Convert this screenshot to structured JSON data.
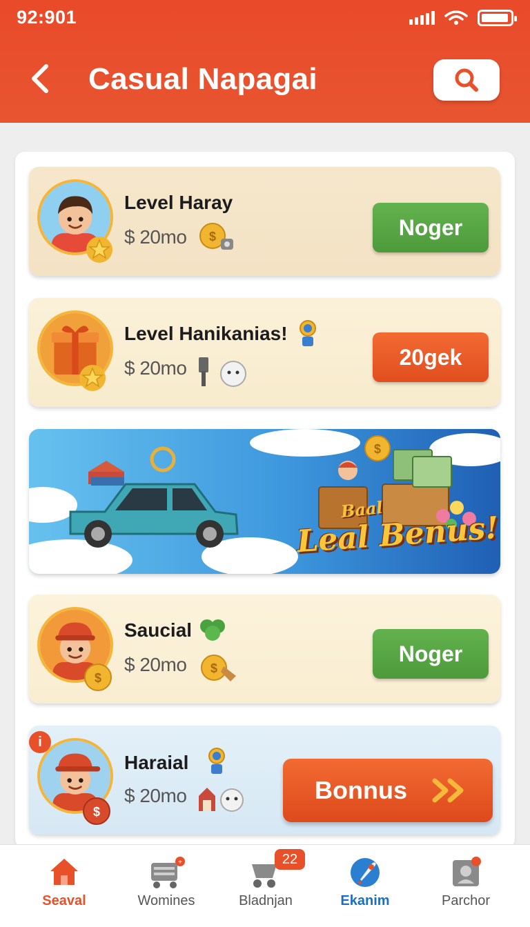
{
  "status_bar": {
    "time": "92:901"
  },
  "header": {
    "title": "Casual Napagai"
  },
  "cards": [
    {
      "title": "Level Haray",
      "price": "$ 20mo",
      "button": "Noger"
    },
    {
      "title": "Level Hanikanias!",
      "price": "$ 20mo",
      "button": "20gek"
    },
    {
      "title": "Saucial",
      "price": "$ 20mo",
      "button": "Noger"
    },
    {
      "title": "Haraial",
      "price": "$ 20mo",
      "button": "Bonnus"
    }
  ],
  "banner": {
    "small_text": "Baal",
    "big_text": "Leal Benus!"
  },
  "alert": "i",
  "bottom_nav": [
    {
      "label": "Seaval"
    },
    {
      "label": "Womines"
    },
    {
      "label": "Bladnjan",
      "badge": "22"
    },
    {
      "label": "Ekanim"
    },
    {
      "label": "Parchor"
    }
  ],
  "colors": {
    "brand": "#e94a2a",
    "green": "#56a443",
    "orange": "#e8502a",
    "blue": "#1a6fbf"
  }
}
